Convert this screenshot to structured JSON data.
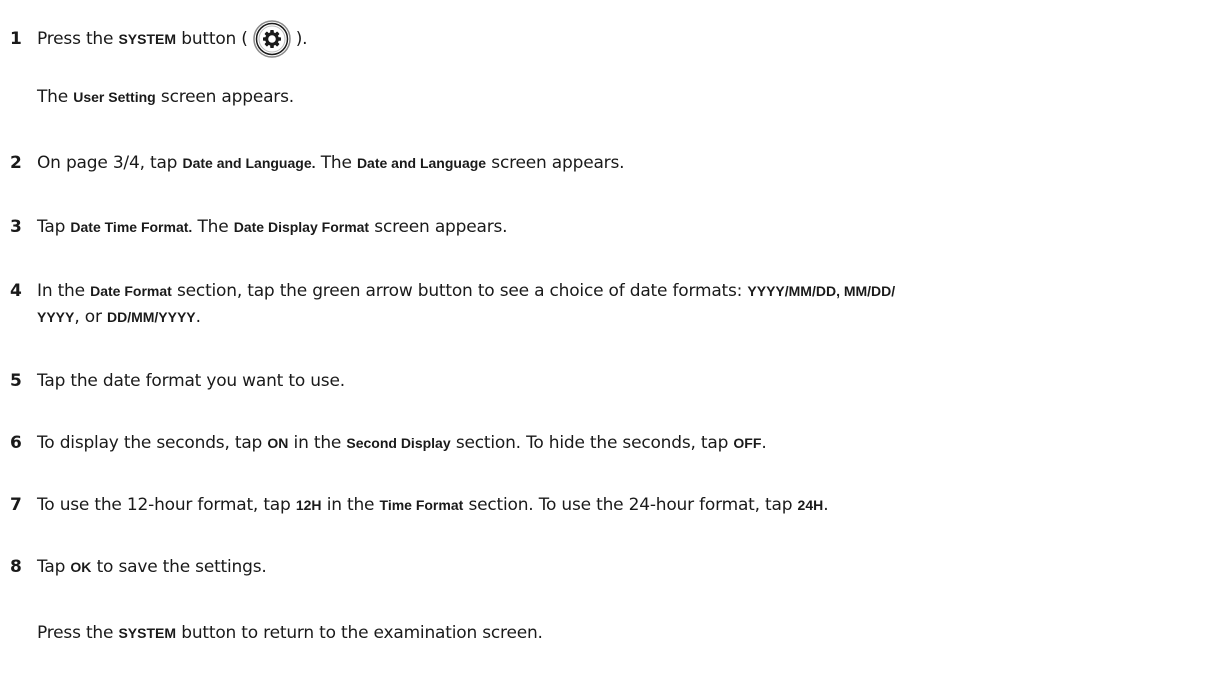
{
  "steps": {
    "s1": {
      "num": "1",
      "a": "Press the ",
      "b": "SYSTEM",
      "c": " button (",
      "d": ").",
      "icon": "gear-icon"
    },
    "s1_note": {
      "a": "The ",
      "b": "User Setting",
      "c": " screen appears."
    },
    "s2": {
      "num": "2",
      "a": "On page 3/4, tap ",
      "b": "Date and Language.",
      "c": " The ",
      "d": "Date and Language",
      "e": " screen appears."
    },
    "s3": {
      "num": "3",
      "a": "Tap ",
      "b": "Date Time Format.",
      "c": " The ",
      "d": "Date Display Format",
      "e": " screen appears."
    },
    "s4": {
      "num": "4",
      "a": "In the ",
      "b": "Date Format",
      "c": " section, tap the green arrow button to see a choice of date formats: ",
      "d": "YYYY/MM/DD, MM/DD/",
      "e": "YYYY",
      "f": ", or ",
      "g": "DD/MM/YYYY",
      "h": "."
    },
    "s5": {
      "num": "5",
      "a": "Tap the date format you want to use."
    },
    "s6": {
      "num": "6",
      "a": "To display the seconds, tap ",
      "b": "ON",
      "c": " in the ",
      "d": "Second Display",
      "e": " section. To hide the seconds, tap ",
      "f": "OFF",
      "g": "."
    },
    "s7": {
      "num": "7",
      "a": "To use the 12-hour format, tap ",
      "b": "12H",
      "c": " in the ",
      "d": "Time Format",
      "e": " section. To use the 24-hour format, tap ",
      "f": "24H",
      "g": "."
    },
    "s8": {
      "num": "8",
      "a": "Tap ",
      "b": "OK",
      "c": " to save the settings."
    },
    "final": {
      "a": "Press the ",
      "b": "SYSTEM",
      "c": " button to return to the examination screen."
    }
  }
}
